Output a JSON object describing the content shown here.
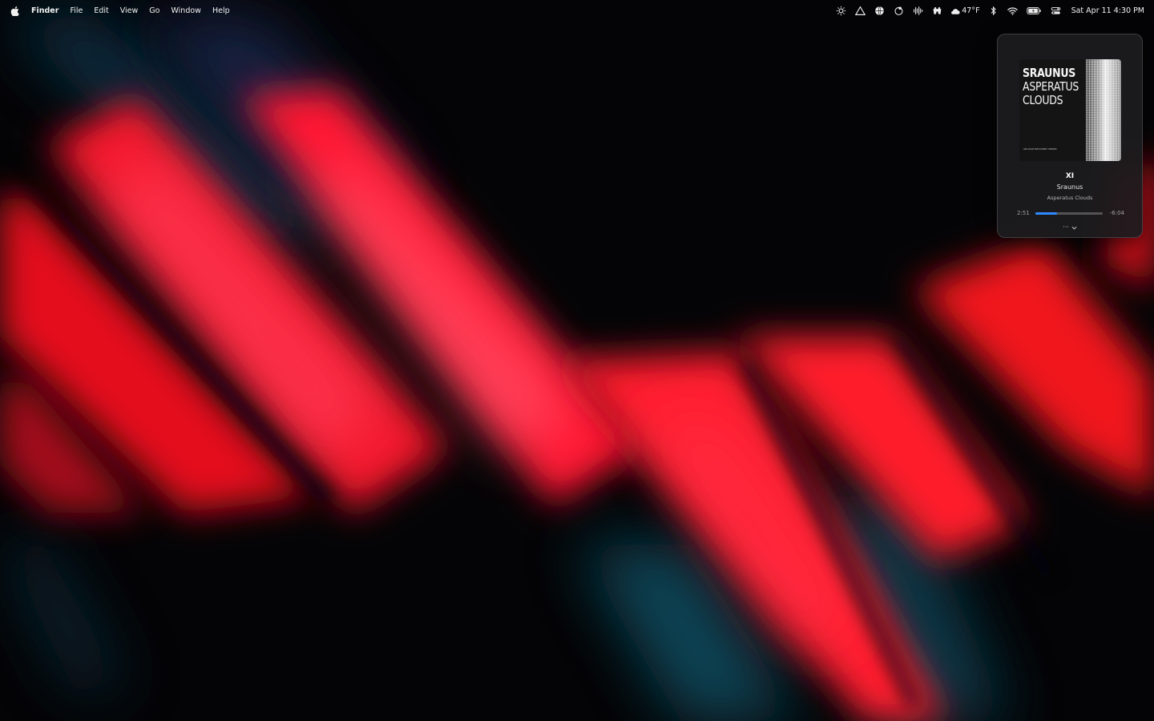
{
  "menubar": {
    "app_name": "Finder",
    "menus": [
      "File",
      "Edit",
      "View",
      "Go",
      "Window",
      "Help"
    ],
    "weather": "47°F",
    "datetime": "Sat Apr 11  4:30 PM",
    "status_icons": [
      "brightness-icon",
      "triangle-icon",
      "globe-icon",
      "shadow-icon",
      "waveform-icon",
      "controller-icon",
      "cloud-icon",
      "bluetooth-icon",
      "wifi-icon",
      "battery-icon",
      "control-center-icon"
    ]
  },
  "now_playing": {
    "album_art": {
      "artist_text": "SRAUNUS",
      "album_line1": "ASPERATUS",
      "album_line2": "CLOUDS",
      "series_text": "AM•IDCE RECOVERY SERIES"
    },
    "track": "XI",
    "artist": "Sraunus",
    "album": "Asperatus Clouds",
    "elapsed": "2:51",
    "remaining": "-6:04",
    "progress": 0.32,
    "more_label": "···"
  },
  "colors": {
    "accent": "#2f8bff",
    "wallpaper_red": "#ff1a2e",
    "wallpaper_teal": "#0e4a5c"
  }
}
